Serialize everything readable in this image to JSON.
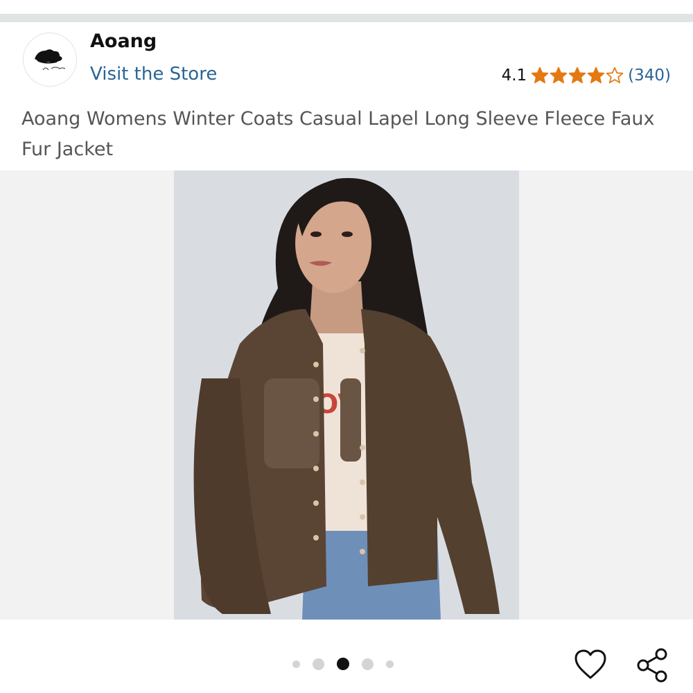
{
  "store": {
    "brand_name": "Aoang",
    "visit_store_label": "Visit the Store",
    "logo_icon": "hat-logo-icon"
  },
  "rating": {
    "value": "4.1",
    "stars_filled": 4,
    "stars_total": 5,
    "review_count": "(340)",
    "star_color": "#e47911"
  },
  "product": {
    "title": "Aoang Womens Winter Coats Casual Lapel Long Sleeve Fleece Faux Fur Jacket",
    "image_alt_icon": "product-photo-woman-brown-fleece-jacket",
    "jacket_color": "#5a4433"
  },
  "carousel": {
    "image_count": 5,
    "active_index": 2
  },
  "actions": {
    "wishlist_icon": "heart-icon",
    "share_icon": "share-icon"
  },
  "colors": {
    "link": "#2a6496",
    "title_text": "#555555",
    "top_bar": "#dfe5e5"
  }
}
